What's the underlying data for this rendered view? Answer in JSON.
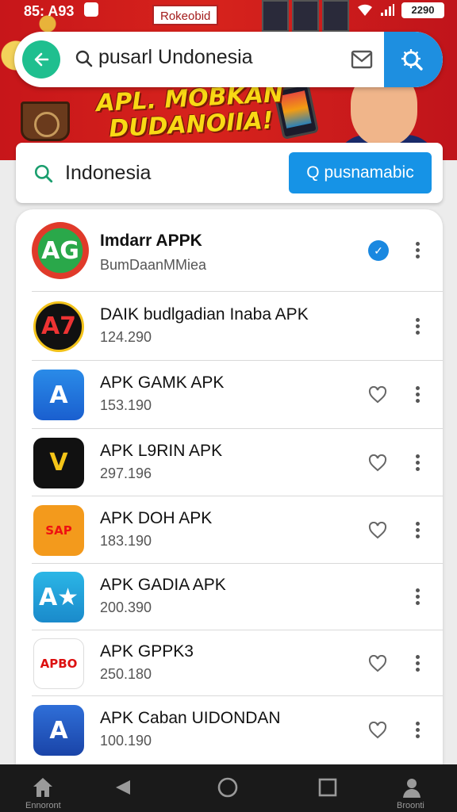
{
  "status": {
    "time": "85: A93",
    "battery": "2290"
  },
  "banner": {
    "label": "Rokeobid",
    "headline_line1": "APL. MOBKAN",
    "headline_line2": "DUDANOIIA!"
  },
  "search": {
    "query": "pusarl Undonesia"
  },
  "search2": {
    "query": "Indonesia",
    "button_label": "Q pusnamabic"
  },
  "apps": [
    {
      "name": "Imdarr APPK",
      "meta": "BumDaanMMiea",
      "action": "check",
      "icon": "AG"
    },
    {
      "name": "DAIK budlgadian Inaba APK",
      "meta": "124.290",
      "action": "none",
      "icon": "A7"
    },
    {
      "name": "APK GAMK APK",
      "meta": "153.190",
      "action": "heart",
      "icon": "A"
    },
    {
      "name": "APK L9RIN  APK",
      "meta": "297.196",
      "action": "heart",
      "icon": "V"
    },
    {
      "name": "APK DOH APK",
      "meta": "183.190",
      "action": "heart",
      "icon": "SAP"
    },
    {
      "name": "APK GADIA APK",
      "meta": "200.390",
      "action": "none",
      "icon": "A★"
    },
    {
      "name": "APK GPPK3",
      "meta": "250.180",
      "action": "heart",
      "icon": "APBO"
    },
    {
      "name": "APK Caban UIDONDAN",
      "meta": "100.190",
      "action": "heart",
      "icon": "A"
    }
  ],
  "nav": {
    "home_label": "Ennoront",
    "profile_label": "Broonti"
  }
}
